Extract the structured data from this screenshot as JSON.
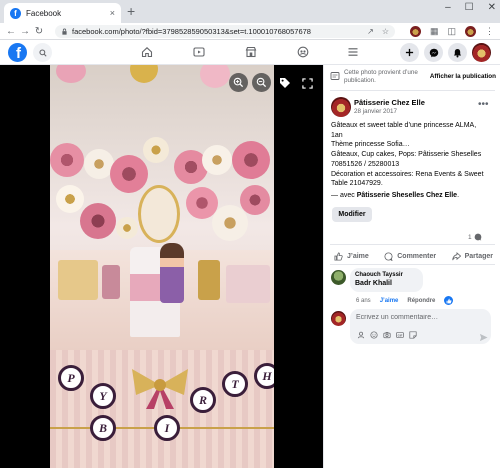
{
  "browser": {
    "tab_title": "Facebook",
    "tab_close": "×",
    "new_tab": "+",
    "url": "facebook.com/photo/?fbid=379852859050313&set=t.100010768057678",
    "controls": [
      "‒",
      "☐",
      "✕"
    ]
  },
  "notice": {
    "text": "Cette photo provient d’une publication.",
    "link": "Afficher la publication"
  },
  "post": {
    "author": "Pâtisserie Chez Elle",
    "date": "28 janvier 2017",
    "more": "•••",
    "caption_lines": [
      "Gâteaux et sweet table d’une princesse ALMA,",
      "1an",
      "Thème princesse Sofia…",
      "Gâteaux, Cup cakes, Pops: Pâtisserie Sheselles",
      "70851526 / 25280013",
      "Décoration et accessoires: Rena Events & Sweet",
      "Table 21047929."
    ],
    "with_prefix": "— avec ",
    "with_name": "Pâtisserie Sheselles Chez Elle",
    "with_suffix": ".",
    "edit_label": "Modifier",
    "comment_count": "1"
  },
  "actions": {
    "like": "J’aime",
    "comment": "Commenter",
    "share": "Partager"
  },
  "comment": {
    "author": "Chaouch Tayssir",
    "text": "Badr Khalil",
    "age": "6 ans",
    "like": "J’aime",
    "reply": "Répondre"
  },
  "composer": {
    "placeholder": "Écrivez un commentaire…"
  },
  "photo": {
    "banner_letters": [
      "P",
      "Y",
      "B",
      "I",
      "R",
      "T",
      "H"
    ]
  },
  "colors": {
    "facebook_blue": "#1877f2",
    "viewer_background": "#000000",
    "secondary_text": "#65676b"
  }
}
